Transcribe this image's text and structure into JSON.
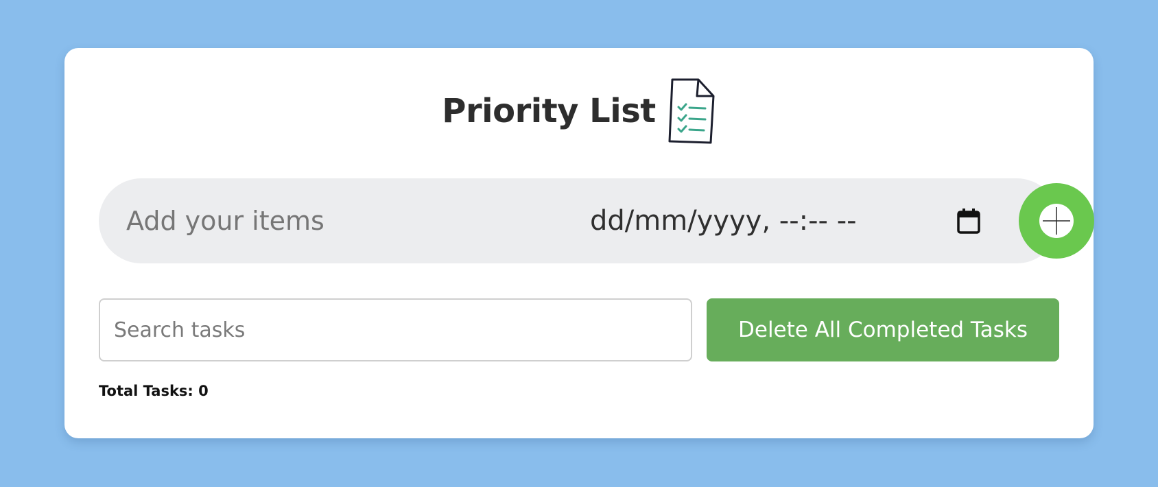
{
  "header": {
    "title": "Priority List",
    "icon": "document-checklist-icon"
  },
  "add_form": {
    "item_placeholder": "Add your items",
    "item_value": "",
    "datetime_placeholder": "dd/mm/yyyy, --:-- --",
    "calendar_icon": "calendar-icon",
    "add_icon": "plus-icon"
  },
  "toolbar": {
    "search_placeholder": "Search tasks",
    "search_value": "",
    "delete_completed_label": "Delete All Completed Tasks"
  },
  "footer": {
    "total_tasks_text": "Total Tasks: 0"
  },
  "colors": {
    "background": "#89bdec",
    "card": "#ffffff",
    "add_row": "#ecedef",
    "add_button": "#6ac84e",
    "delete_button": "#67ad5b",
    "checkmark_accent": "#3aa58a"
  }
}
